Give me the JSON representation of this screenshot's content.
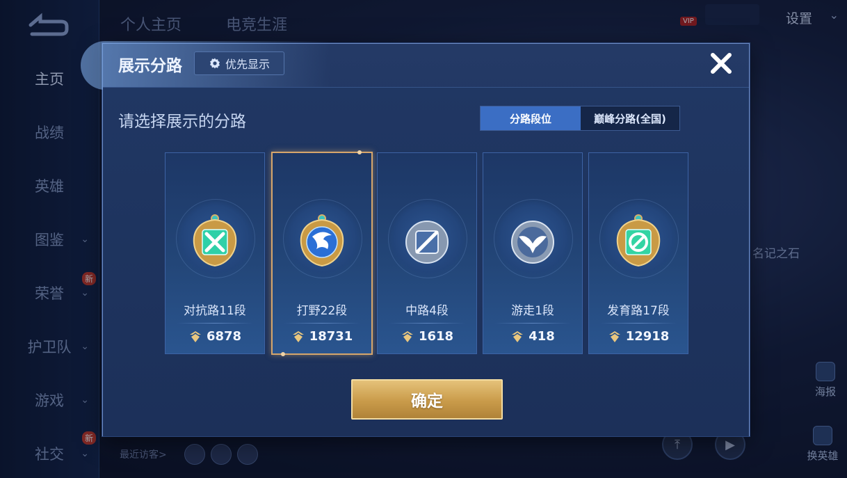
{
  "sidebar": {
    "items": [
      {
        "label": "主页"
      },
      {
        "label": "战绩"
      },
      {
        "label": "英雄"
      },
      {
        "label": "图鉴"
      },
      {
        "label": "荣誉",
        "badge": "新"
      },
      {
        "label": "护卫队"
      },
      {
        "label": "游戏"
      },
      {
        "label": "社交",
        "badge": "新"
      }
    ]
  },
  "top_tabs": [
    "个人主页",
    "电竞生涯"
  ],
  "header": {
    "settings_label": "设置",
    "vip_label": "VIP"
  },
  "background": {
    "side_label": "名记之石",
    "visitors_label": "最近访客>",
    "right_icons": [
      {
        "label": "海报"
      },
      {
        "label": "换英雄"
      }
    ]
  },
  "modal": {
    "title": "展示分路",
    "priority_label": "优先显示",
    "subtitle": "请选择展示的分路",
    "toggle": {
      "active": "分路段位",
      "inactive": "巅峰分路(全国)"
    },
    "lanes": [
      {
        "name": "对抗路11段",
        "score": "6878",
        "icon": "clash-lane-icon",
        "color": "#2fd0a8",
        "selected": false
      },
      {
        "name": "打野22段",
        "score": "18731",
        "icon": "jungle-dragon-icon",
        "color": "#3f8ff0",
        "selected": true
      },
      {
        "name": "中路4段",
        "score": "1618",
        "icon": "mid-lane-icon",
        "color": "#9fb3cc",
        "selected": false
      },
      {
        "name": "游走1段",
        "score": "418",
        "icon": "roam-lane-icon",
        "color": "#b7c7dc",
        "selected": false
      },
      {
        "name": "发育路17段",
        "score": "12918",
        "icon": "farm-lane-icon",
        "color": "#33d4a3",
        "selected": false
      }
    ],
    "confirm_label": "确定"
  },
  "colors": {
    "accent_gold": "#d6a66c",
    "toggle_active": "#3b6ec4",
    "panel": "#203763"
  }
}
